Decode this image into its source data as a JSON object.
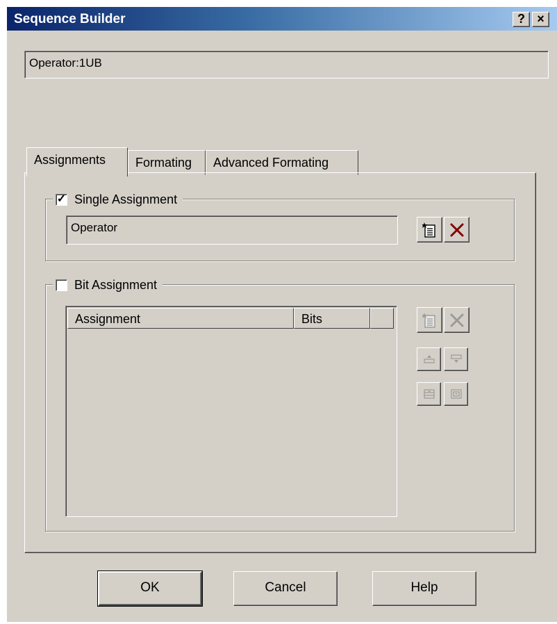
{
  "window": {
    "title": "Sequence Builder",
    "help_glyph": "?",
    "close_glyph": "×"
  },
  "operator_field": {
    "value": "Operator:1UB"
  },
  "tabs": [
    {
      "label": "Assignments",
      "active": true
    },
    {
      "label": "Formating",
      "active": false
    },
    {
      "label": "Advanced Formating",
      "active": false
    }
  ],
  "single_assignment": {
    "label": "Single Assignment",
    "checked": true,
    "value": "Operator"
  },
  "bit_assignment": {
    "label": "Bit Assignment",
    "checked": false,
    "columns": [
      "Assignment",
      "Bits"
    ],
    "rows": []
  },
  "icons": {
    "new": "new-assignment-icon",
    "delete": "delete-icon",
    "move_up": "move-up-icon",
    "move_down": "move-down-icon",
    "move_top": "move-to-top-icon",
    "move_bottom": "move-to-bottom-icon"
  },
  "buttons": {
    "ok": "OK",
    "cancel": "Cancel",
    "help": "Help"
  },
  "colors": {
    "title_start": "#0a246a",
    "title_end": "#a6caf0",
    "face": "#d4d0c8",
    "delete_red": "#800000"
  }
}
